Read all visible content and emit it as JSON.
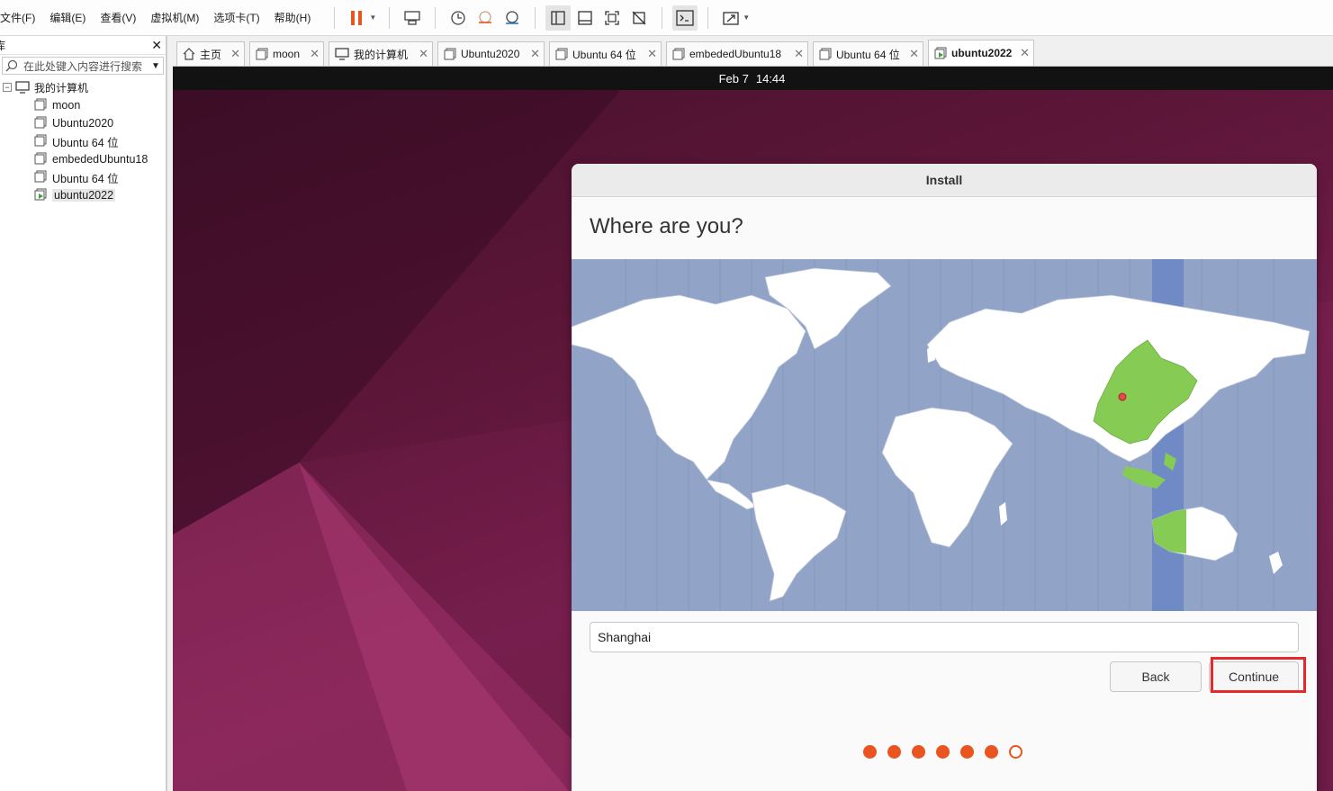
{
  "menu": {
    "items": [
      "文件(F)",
      "编辑(E)",
      "查看(V)",
      "虚拟机(M)",
      "选项卡(T)",
      "帮助(H)"
    ]
  },
  "toolbar": {
    "icons": [
      "pause-icon",
      "send-keys-icon",
      "snapshot-icon",
      "revert-snapshot-icon",
      "manage-snapshots-icon",
      "show-library-icon",
      "thumbnail-bar-icon",
      "full-screen-icon",
      "unity-icon",
      "console-icon",
      "stretch-icon"
    ]
  },
  "library": {
    "title": "库",
    "search_placeholder": "在此处键入内容进行搜索",
    "root_label": "我的计算机",
    "items": [
      "moon",
      "Ubuntu2020",
      "Ubuntu 64 位",
      "embededUbuntu18",
      "Ubuntu 64 位",
      "ubuntu2022"
    ],
    "selected": "ubuntu2022"
  },
  "tabs": [
    {
      "label": "主页",
      "icon": "home-icon"
    },
    {
      "label": "moon",
      "icon": "vm-icon"
    },
    {
      "label": "我的计算机",
      "icon": "computer-icon"
    },
    {
      "label": "Ubuntu2020",
      "icon": "vm-icon"
    },
    {
      "label": "Ubuntu 64 位",
      "icon": "vm-icon"
    },
    {
      "label": "embededUbuntu18",
      "icon": "vm-icon"
    },
    {
      "label": "Ubuntu 64 位",
      "icon": "vm-icon"
    },
    {
      "label": "ubuntu2022",
      "icon": "vm-running-icon",
      "active": true
    }
  ],
  "guest": {
    "clock_date": "Feb 7",
    "clock_time": "14:44",
    "installer": {
      "window_title": "Install",
      "heading": "Where are you?",
      "timezone_value": "Shanghai",
      "back_label": "Back",
      "continue_label": "Continue",
      "progress": {
        "completed": 6,
        "total": 7
      }
    }
  },
  "colors": {
    "ubuntu_orange": "#e95420",
    "map_ocean": "#91a4c8",
    "map_highlight": "#86cc54",
    "highlight_box": "#e8292b"
  }
}
